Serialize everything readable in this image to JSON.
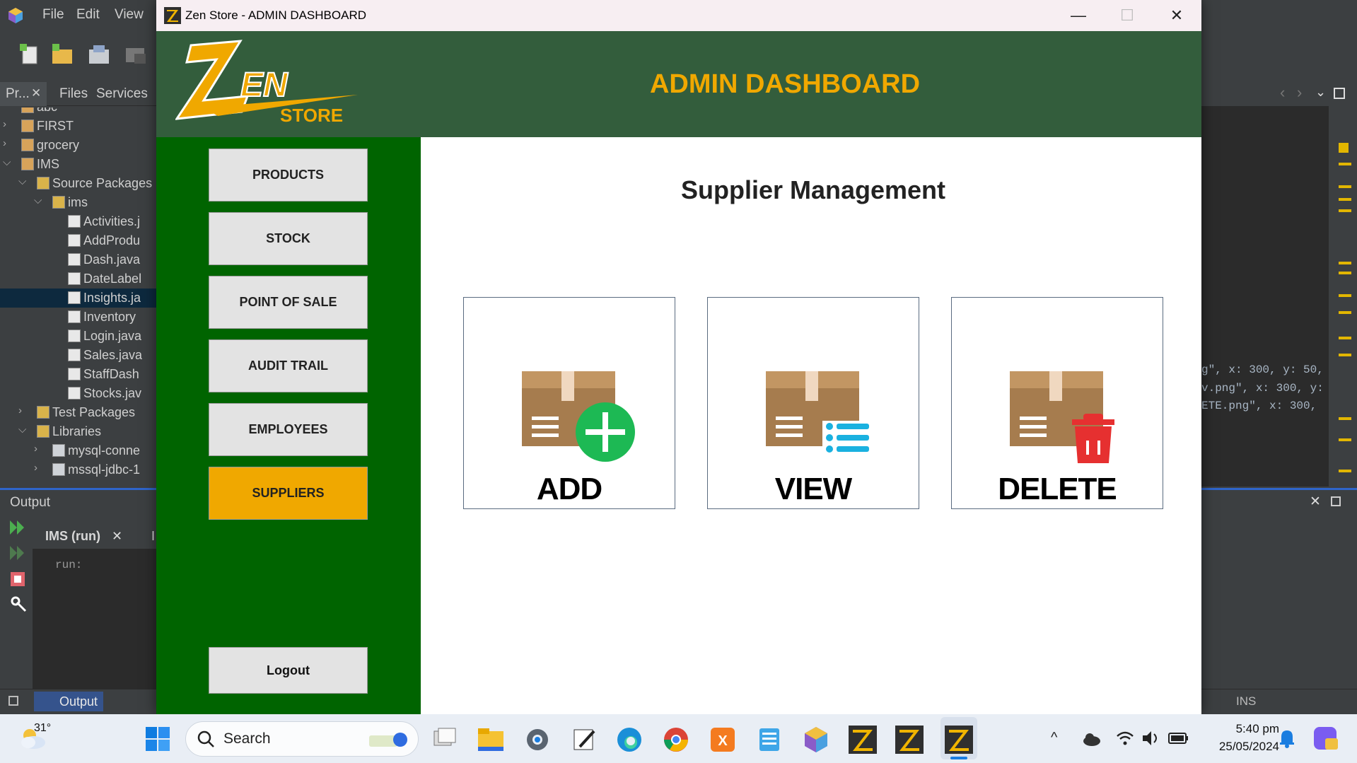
{
  "ide": {
    "menu": [
      "File",
      "Edit",
      "View"
    ],
    "tabs": [
      "Pr...",
      "Files",
      "Services"
    ],
    "tree": [
      {
        "label": "abc",
        "indent": 0
      },
      {
        "label": "FIRST",
        "indent": 0
      },
      {
        "label": "grocery",
        "indent": 0
      },
      {
        "label": "IMS",
        "indent": 0
      },
      {
        "label": "Source Packages",
        "indent": 1
      },
      {
        "label": "ims",
        "indent": 2
      },
      {
        "label": "Activities.j",
        "indent": 3
      },
      {
        "label": "AddProdu",
        "indent": 3
      },
      {
        "label": "Dash.java",
        "indent": 3
      },
      {
        "label": "DateLabel",
        "indent": 3
      },
      {
        "label": "Insights.ja",
        "indent": 3,
        "selected": true
      },
      {
        "label": "Inventory",
        "indent": 3
      },
      {
        "label": "Login.java",
        "indent": 3
      },
      {
        "label": "Sales.java",
        "indent": 3
      },
      {
        "label": "StaffDash",
        "indent": 3
      },
      {
        "label": "Stocks.jav",
        "indent": 3
      },
      {
        "label": "Test Packages",
        "indent": 1
      },
      {
        "label": "Libraries",
        "indent": 1
      },
      {
        "label": "mysql-conne",
        "indent": 2
      },
      {
        "label": "mssql-jdbc-1",
        "indent": 2
      }
    ],
    "output_title": "Output",
    "run_tab": "IMS (run)",
    "run_tab_extra": "I",
    "output_text": "run:",
    "status_output": "Output",
    "status_ins": "INS",
    "code_lines": [
      "g\", x: 300, y: 50,",
      "v.png\", x: 300, y:",
      "ETE.png\", x: 300,"
    ]
  },
  "app": {
    "window_title": "Zen Store - ADMIN DASHBOARD",
    "logo_text_zen": "EN",
    "logo_text_store": "STORE",
    "header_title": "ADMIN DASHBOARD",
    "nav": [
      "PRODUCTS",
      "STOCK",
      "POINT OF SALE",
      "AUDIT TRAIL",
      "EMPLOYEES",
      "SUPPLIERS"
    ],
    "active_nav": "SUPPLIERS",
    "logout": "Logout",
    "main_title": "Supplier Management",
    "cards": [
      "ADD",
      "VIEW",
      "DELETE"
    ],
    "colors": {
      "header_bg": "#335d3c",
      "sidebar_bg": "#006400",
      "accent": "#f0a800",
      "add_green": "#1db954",
      "view_blue": "#1ab1e0",
      "delete_red": "#e63030"
    }
  },
  "taskbar": {
    "temp": "31°",
    "search": "Search",
    "time": "5:40 pm",
    "date": "25/05/2024"
  }
}
